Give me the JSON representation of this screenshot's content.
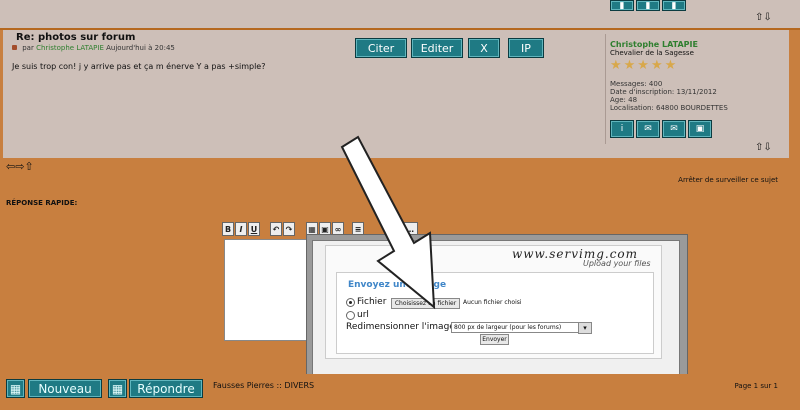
{
  "top": {
    "arrows": "⇧⇩"
  },
  "post": {
    "title": "Re: photos sur forum",
    "meta_prefix": "par",
    "author": "Christophe LATAPIE",
    "date": "Aujourd'hui à 20:45",
    "body": "Je suis trop con! j y arrive pas et ça m énerve Y a pas +simple?",
    "buttons": {
      "quote": "Citer",
      "edit": "Editer",
      "delete": "X",
      "ip": "IP"
    },
    "bottom_arrows": "⇧⇩"
  },
  "profile": {
    "name": "Christophe LATAPIE",
    "rank": "Chevalier de la Sagesse",
    "stars": "★★★★★",
    "messages": "Messages: 400",
    "inscription": "Date d'inscription: 13/11/2012",
    "age": "Age: 48",
    "location": "Localisation: 64800 BOURDETTES"
  },
  "nav": {
    "arrows": "⇦⇨⇧",
    "unwatch": "Arrêter de surveiller ce sujet"
  },
  "quick_reply": {
    "label": "RÉPONSE RAPIDE:",
    "toolbar": {
      "bold": "B",
      "italic": "I",
      "underline": "U"
    }
  },
  "popup": {
    "logo": "www.servimg.com",
    "subtitle": "Upload your files",
    "title": "Envoyez une image",
    "file_label": "Fichier",
    "choose_button": "Choisissez un fichier",
    "no_file": "Aucun fichier choisi",
    "url_label": "url",
    "resize_label": "Redimensionner l'image",
    "resize_value": "800 px de largeur (pour les forums)",
    "send_button": "Envoyer"
  },
  "bottom": {
    "new_button": "Nouveau",
    "reply_button": "Répondre",
    "breadcrumb": "Fausses Pierres :: DIVERS",
    "page": "Page 1 sur 1"
  }
}
